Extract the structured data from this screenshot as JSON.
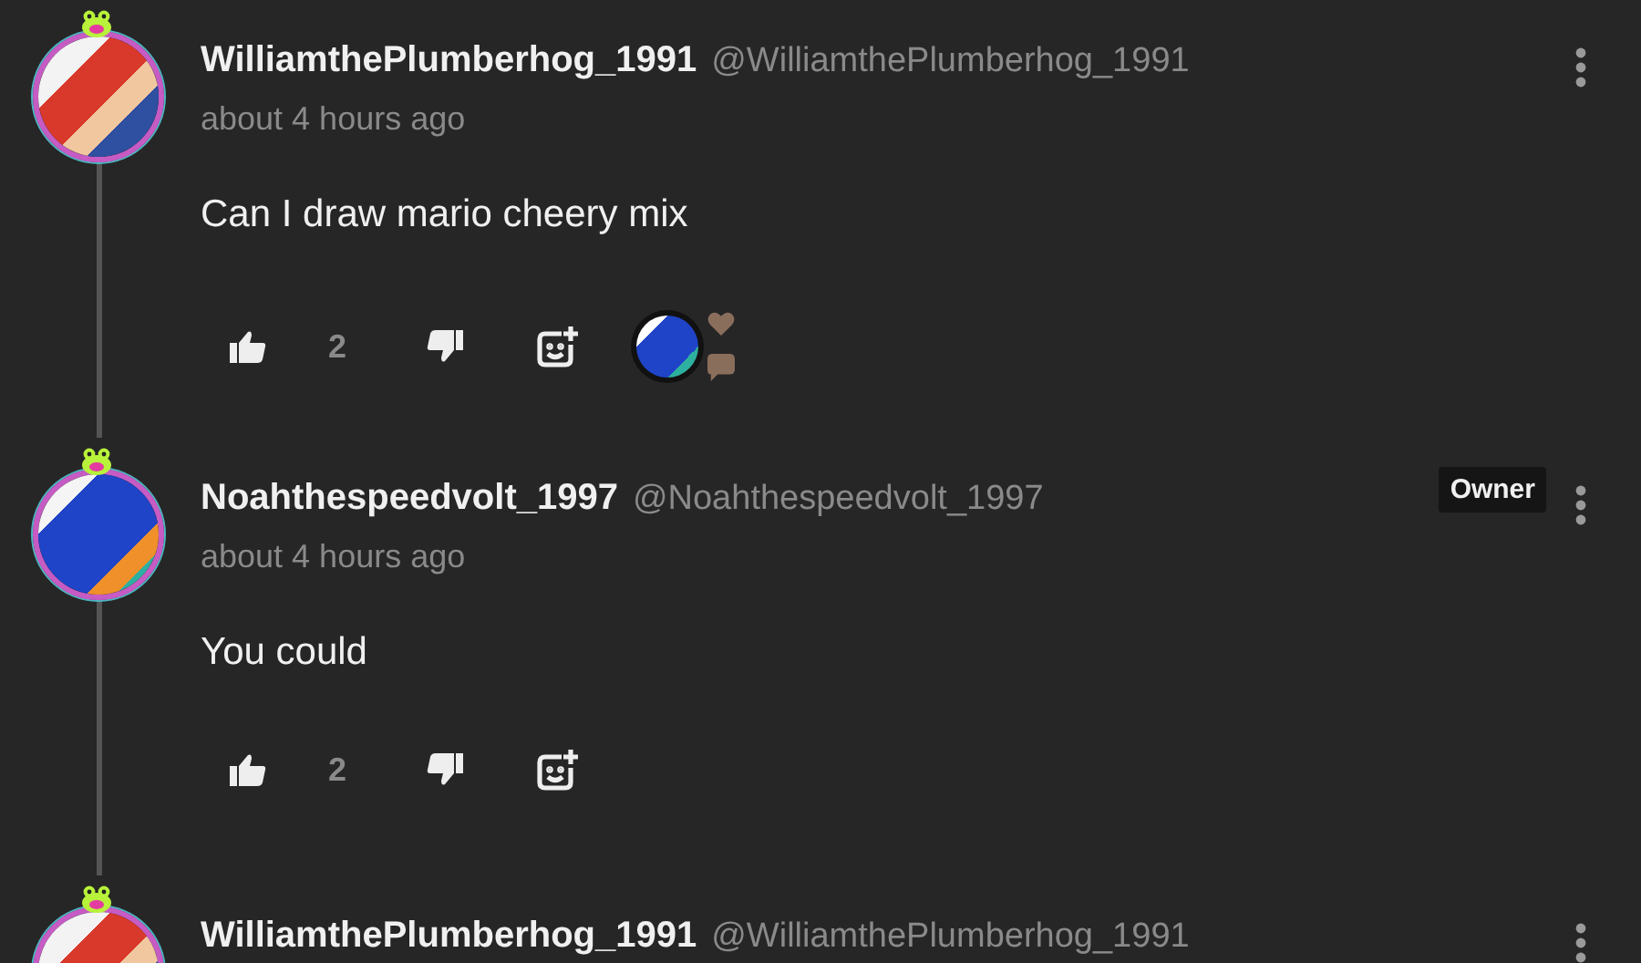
{
  "comments": [
    {
      "username": "WilliamthePlumberhog_1991",
      "handle": "@WilliamthePlumberhog_1991",
      "time": "about 4 hours ago",
      "text": "Can I draw mario cheery mix",
      "likes": "2",
      "reactor": true
    },
    {
      "username": "Noahthespeedvolt_1997",
      "handle": "@Noahthespeedvolt_1997",
      "badge": "Owner",
      "time": "about 4 hours ago",
      "text": "You could",
      "likes": "2",
      "reactor": false
    },
    {
      "username": "WilliamthePlumberhog_1991",
      "handle": "@WilliamthePlumberhog_1991"
    }
  ]
}
